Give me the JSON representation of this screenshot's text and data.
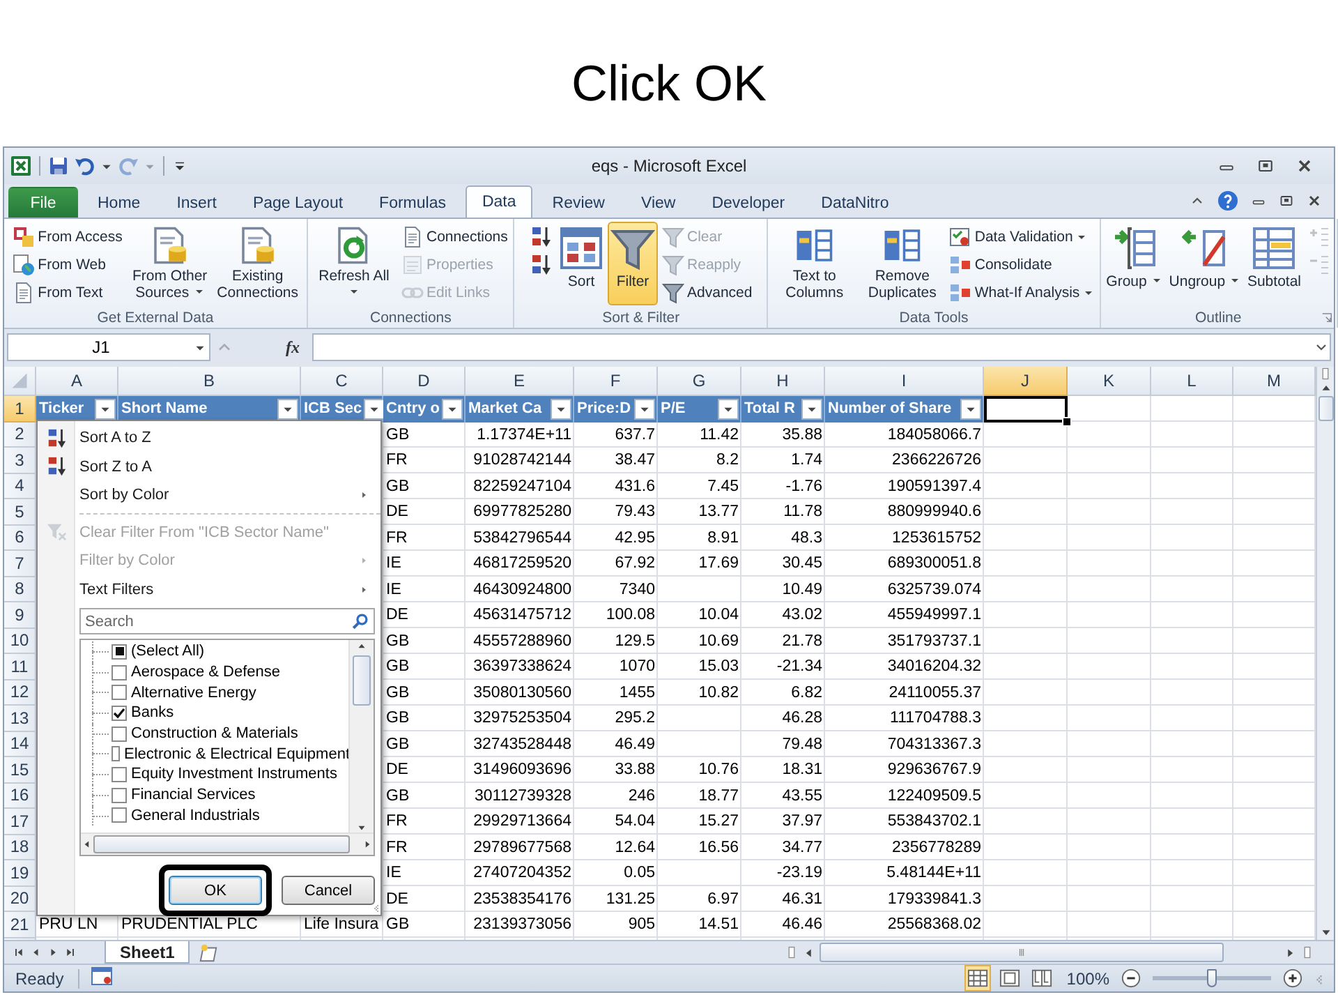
{
  "slide_title": "Click OK",
  "window": {
    "title": "eqs - Microsoft Excel"
  },
  "quick_access": [
    {
      "kind": "save",
      "disabled": false
    },
    {
      "kind": "undo",
      "disabled": false
    },
    {
      "kind": "redo",
      "disabled": true
    }
  ],
  "ribbon": {
    "tabs": [
      {
        "label": "File",
        "kind": "file",
        "selected": false
      },
      {
        "label": "Home",
        "kind": "tab",
        "selected": false
      },
      {
        "label": "Insert",
        "kind": "tab",
        "selected": false
      },
      {
        "label": "Page Layout",
        "kind": "tab",
        "selected": false
      },
      {
        "label": "Formulas",
        "kind": "tab",
        "selected": false
      },
      {
        "label": "Data",
        "kind": "tab",
        "selected": true
      },
      {
        "label": "Review",
        "kind": "tab",
        "selected": false
      },
      {
        "label": "View",
        "kind": "tab",
        "selected": false
      },
      {
        "label": "Developer",
        "kind": "tab",
        "selected": false
      },
      {
        "label": "DataNitro",
        "kind": "tab",
        "selected": false
      }
    ],
    "groups": [
      {
        "label": "Get External Data",
        "launcher": false,
        "controls": [
          {
            "kind": "stack",
            "items": [
              {
                "label": "From Access",
                "disabled": false,
                "dropdown": false
              },
              {
                "label": "From Web",
                "disabled": false,
                "dropdown": false
              },
              {
                "label": "From Text",
                "disabled": false,
                "dropdown": false
              }
            ]
          },
          {
            "kind": "large",
            "label": "From Other Sources",
            "disabled": false,
            "active": false,
            "dropdown": true
          },
          {
            "kind": "large",
            "label": "Existing Connections",
            "disabled": false,
            "active": false,
            "dropdown": false
          }
        ]
      },
      {
        "label": "Connections",
        "launcher": false,
        "controls": [
          {
            "kind": "large",
            "label": "Refresh All",
            "disabled": false,
            "active": false,
            "dropdown": true
          },
          {
            "kind": "stack",
            "items": [
              {
                "label": "Connections",
                "disabled": false,
                "dropdown": false
              },
              {
                "label": "Properties",
                "disabled": true,
                "dropdown": false
              },
              {
                "label": "Edit Links",
                "disabled": true,
                "dropdown": false
              }
            ]
          }
        ]
      },
      {
        "label": "Sort & Filter",
        "launcher": false,
        "controls": [
          {
            "kind": "stack",
            "items": [
              {
                "disabled": false,
                "dropdown": false
              },
              {
                "disabled": false,
                "dropdown": false
              }
            ]
          },
          {
            "kind": "large",
            "label": "Sort",
            "disabled": false,
            "active": false,
            "dropdown": false
          },
          {
            "kind": "large",
            "label": "Filter",
            "disabled": false,
            "active": true,
            "dropdown": false
          },
          {
            "kind": "stack",
            "items": [
              {
                "label": "Clear",
                "disabled": true,
                "dropdown": false
              },
              {
                "label": "Reapply",
                "disabled": true,
                "dropdown": false
              },
              {
                "label": "Advanced",
                "disabled": false,
                "dropdown": false
              }
            ]
          }
        ]
      },
      {
        "label": "Data Tools",
        "launcher": false,
        "controls": [
          {
            "kind": "large",
            "label": "Text to Columns",
            "disabled": false,
            "active": false,
            "dropdown": false
          },
          {
            "kind": "large",
            "label": "Remove Duplicates",
            "disabled": false,
            "active": false,
            "dropdown": false
          },
          {
            "kind": "stack",
            "items": [
              {
                "label": "Data Validation",
                "disabled": false,
                "dropdown": true
              },
              {
                "label": "Consolidate",
                "disabled": false,
                "dropdown": false
              },
              {
                "label": "What-If Analysis",
                "disabled": false,
                "dropdown": true
              }
            ]
          }
        ]
      },
      {
        "label": "Outline",
        "launcher": true,
        "controls": [
          {
            "kind": "large",
            "label": "Group",
            "disabled": false,
            "active": false,
            "dropdown": true
          },
          {
            "kind": "large",
            "label": "Ungroup",
            "disabled": false,
            "active": false,
            "dropdown": true
          },
          {
            "kind": "large",
            "label": "Subtotal",
            "disabled": false,
            "active": false,
            "dropdown": false
          },
          {
            "kind": "stack",
            "items": [
              {
                "disabled": true,
                "dropdown": false
              },
              {
                "disabled": true,
                "dropdown": false
              }
            ]
          }
        ]
      }
    ]
  },
  "formula_bar": {
    "name_box": "J1",
    "function_label": "fx"
  },
  "sheet": {
    "columns": [
      {
        "letter": "A",
        "selected": false,
        "numeric": false
      },
      {
        "letter": "B",
        "selected": false,
        "numeric": false
      },
      {
        "letter": "C",
        "selected": false,
        "numeric": false
      },
      {
        "letter": "D",
        "selected": false,
        "numeric": false
      },
      {
        "letter": "E",
        "selected": false,
        "numeric": true
      },
      {
        "letter": "F",
        "selected": false,
        "numeric": true
      },
      {
        "letter": "G",
        "selected": false,
        "numeric": true
      },
      {
        "letter": "H",
        "selected": false,
        "numeric": true
      },
      {
        "letter": "I",
        "selected": false,
        "numeric": true
      },
      {
        "letter": "J",
        "selected": true
      },
      {
        "letter": "K",
        "selected": false
      },
      {
        "letter": "L",
        "selected": false
      },
      {
        "letter": "M",
        "selected": false
      }
    ],
    "header_row": {
      "number": "1",
      "selected": true,
      "cells": [
        {
          "text": "Ticker",
          "filter": true,
          "active": false
        },
        {
          "text": "Short Name",
          "filter": true,
          "active": false
        },
        {
          "text": "ICB Sec",
          "filter": true,
          "active": false
        },
        {
          "text": "Cntry o",
          "filter": true,
          "active": false
        },
        {
          "text": "Market Ca",
          "filter": true,
          "active": false
        },
        {
          "text": "Price:D",
          "filter": true,
          "active": false
        },
        {
          "text": "P/E",
          "filter": true,
          "active": false
        },
        {
          "text": "Total R",
          "filter": true,
          "active": false
        },
        {
          "text": "Number of Share",
          "filter": true,
          "active": false
        },
        {
          "filter": false,
          "active": true
        }
      ]
    },
    "rows": [
      {
        "number": "2",
        "selected": false,
        "cells": [
          null,
          null,
          null,
          "GB",
          "1.17374E+11",
          "637.7",
          "11.42",
          "35.88",
          "184058066.7"
        ]
      },
      {
        "number": "3",
        "selected": false,
        "cells": [
          null,
          null,
          null,
          "FR",
          "91028742144",
          "38.47",
          "8.2",
          "1.74",
          "2366226726"
        ]
      },
      {
        "number": "4",
        "selected": false,
        "cells": [
          null,
          null,
          null,
          "GB",
          "82259247104",
          "431.6",
          "7.45",
          "-1.76",
          "190591397.4"
        ]
      },
      {
        "number": "5",
        "selected": false,
        "cells": [
          null,
          null,
          null,
          "DE",
          "69977825280",
          "79.43",
          "13.77",
          "11.78",
          "880999940.6"
        ]
      },
      {
        "number": "6",
        "selected": false,
        "cells": [
          null,
          null,
          null,
          "FR",
          "53842796544",
          "42.95",
          "8.91",
          "48.3",
          "1253615752"
        ]
      },
      {
        "number": "7",
        "selected": false,
        "cells": [
          null,
          null,
          null,
          "IE",
          "46817259520",
          "67.92",
          "17.69",
          "30.45",
          "689300051.8"
        ]
      },
      {
        "number": "8",
        "selected": false,
        "cells": [
          null,
          null,
          null,
          "IE",
          "46430924800",
          "7340",
          null,
          "10.49",
          "6325739.074"
        ]
      },
      {
        "number": "9",
        "selected": false,
        "cells": [
          null,
          null,
          null,
          "DE",
          "45631475712",
          "100.08",
          "10.04",
          "43.02",
          "455949997.1"
        ]
      },
      {
        "number": "10",
        "selected": false,
        "cells": [
          null,
          null,
          null,
          "GB",
          "45557288960",
          "129.5",
          "10.69",
          "21.78",
          "351793737.1"
        ]
      },
      {
        "number": "11",
        "selected": false,
        "cells": [
          null,
          null,
          null,
          "GB",
          "36397338624",
          "1070",
          "15.03",
          "-21.34",
          "34016204.32"
        ]
      },
      {
        "number": "12",
        "selected": false,
        "cells": [
          null,
          null,
          null,
          "GB",
          "35080130560",
          "1455",
          "10.82",
          "6.82",
          "24110055.37"
        ]
      },
      {
        "number": "13",
        "selected": false,
        "cells": [
          null,
          null,
          null,
          "GB",
          "32975253504",
          "295.2",
          null,
          "46.28",
          "111704788.3"
        ]
      },
      {
        "number": "14",
        "selected": false,
        "cells": [
          null,
          null,
          null,
          "GB",
          "32743528448",
          "46.49",
          null,
          "79.48",
          "704313367.3"
        ]
      },
      {
        "number": "15",
        "selected": false,
        "cells": [
          null,
          null,
          null,
          "DE",
          "31496093696",
          "33.88",
          "10.76",
          "18.31",
          "929636767.9"
        ]
      },
      {
        "number": "16",
        "selected": false,
        "cells": [
          null,
          null,
          null,
          "GB",
          "30112739328",
          "246",
          "18.77",
          "43.55",
          "122409509.5"
        ]
      },
      {
        "number": "17",
        "selected": false,
        "cells": [
          null,
          null,
          null,
          "FR",
          "29929713664",
          "54.04",
          "15.27",
          "37.97",
          "553843702.1"
        ]
      },
      {
        "number": "18",
        "selected": false,
        "cells": [
          null,
          null,
          null,
          "FR",
          "29789677568",
          "12.64",
          "16.56",
          "34.77",
          "2356778289"
        ]
      },
      {
        "number": "19",
        "selected": false,
        "cells": [
          null,
          null,
          null,
          "IE",
          "27407204352",
          "0.05",
          null,
          "-23.19",
          "5.48144E+11"
        ]
      },
      {
        "number": "20",
        "selected": false,
        "cells": [
          null,
          null,
          null,
          "DE",
          "23538354176",
          "131.25",
          "6.97",
          "46.31",
          "179339841.3"
        ]
      },
      {
        "number": "21",
        "selected": false,
        "cells": [
          "PRU LN",
          "PRUDENTIAL PLC",
          "Life Insura",
          "GB",
          "23139373056",
          "905",
          "14.51",
          "46.46",
          "25568368.02"
        ]
      }
    ],
    "tabs": [
      {
        "label": "Sheet1",
        "selected": true
      }
    ]
  },
  "filter_menu": {
    "items": [
      {
        "kind": "command",
        "label": "Sort A to Z",
        "disabled": false,
        "submenu": false
      },
      {
        "kind": "command",
        "label": "Sort Z to A",
        "disabled": false,
        "submenu": false
      },
      {
        "kind": "command",
        "label": "Sort by Color",
        "disabled": false,
        "submenu": true
      },
      {
        "kind": "separator"
      },
      {
        "kind": "command",
        "label": "Clear Filter From \"ICB Sector Name\"",
        "disabled": true,
        "submenu": false
      },
      {
        "kind": "command",
        "label": "Filter by Color",
        "disabled": true,
        "submenu": true
      },
      {
        "kind": "command",
        "label": "Text Filters",
        "disabled": false,
        "submenu": true
      }
    ],
    "search": {
      "placeholder": "Search"
    },
    "values": [
      {
        "label": "(Select All)",
        "checked": false,
        "partial": true
      },
      {
        "label": "Aerospace & Defense",
        "checked": false,
        "partial": false
      },
      {
        "label": "Alternative Energy",
        "checked": false,
        "partial": false
      },
      {
        "label": "Banks",
        "checked": true,
        "partial": false
      },
      {
        "label": "Construction & Materials",
        "checked": false,
        "partial": false
      },
      {
        "label": "Electronic & Electrical Equipment",
        "checked": false,
        "partial": false
      },
      {
        "label": "Equity Investment Instruments",
        "checked": false,
        "partial": false
      },
      {
        "label": "Financial Services",
        "checked": false,
        "partial": false
      },
      {
        "label": "General Industrials",
        "checked": false,
        "partial": false
      }
    ],
    "buttons": [
      {
        "label": "OK",
        "highlighted": true
      },
      {
        "label": "Cancel",
        "highlighted": false
      }
    ]
  },
  "status_bar": {
    "text": "Ready",
    "views": [
      {
        "kind": "normal",
        "selected": true
      },
      {
        "kind": "page-layout",
        "selected": false
      },
      {
        "kind": "page-break",
        "selected": false
      }
    ],
    "zoom": {
      "reading": "100%",
      "level": 0.5
    }
  }
}
